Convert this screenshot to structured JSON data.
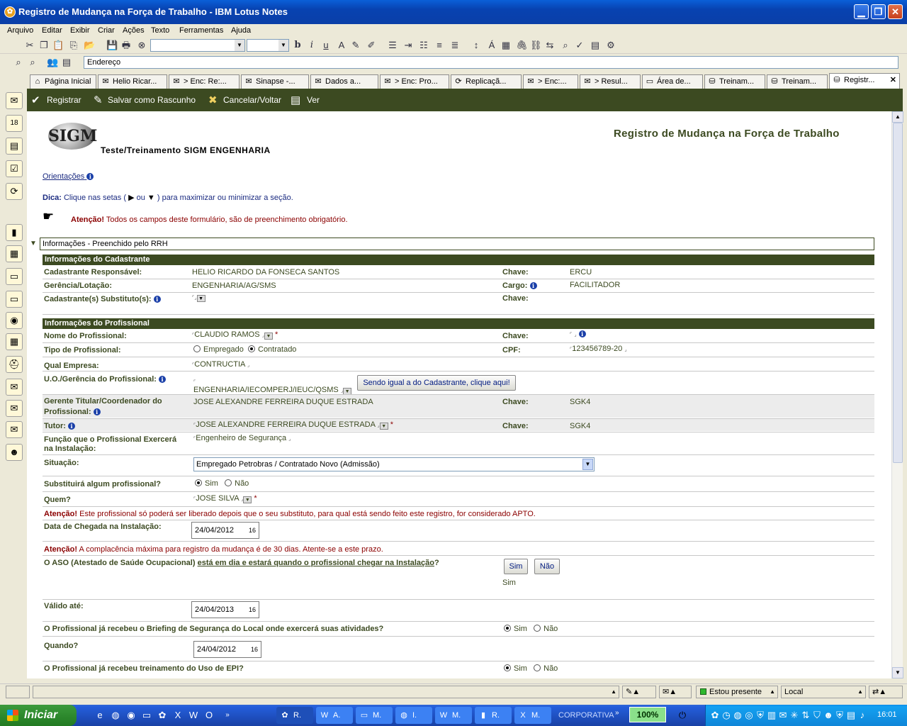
{
  "window": {
    "title": "Registro de Mudança na Força de Trabalho - IBM Lotus Notes"
  },
  "menu": [
    "Arquivo",
    "Editar",
    "Exibir",
    "Criar",
    "Ações",
    "Texto",
    "Ferramentas",
    "Ajuda"
  ],
  "address": {
    "label": "Endereço"
  },
  "tabs": [
    {
      "label": "Página Inicial",
      "icon": "home-icon"
    },
    {
      "label": "Helio Ricar...",
      "icon": "mail-icon"
    },
    {
      "label": "> Enc: Re:...",
      "icon": "memo-icon"
    },
    {
      "label": "Sinapse -...",
      "icon": "memo-icon"
    },
    {
      "label": "Dados a...",
      "icon": "memo-icon"
    },
    {
      "label": "> Enc: Pro...",
      "icon": "memo-icon"
    },
    {
      "label": "Replicaçã...",
      "icon": "replication-icon"
    },
    {
      "label": "> Enc:...",
      "icon": "memo-icon"
    },
    {
      "label": "> Resul...",
      "icon": "memo-icon"
    },
    {
      "label": "Área de...",
      "icon": "folder-icon"
    },
    {
      "label": "Treinam...",
      "icon": "database-icon"
    },
    {
      "label": "Treinam...",
      "icon": "database-icon"
    },
    {
      "label": "Registr...",
      "icon": "form-icon"
    }
  ],
  "actions": {
    "register": "Registrar",
    "save_draft": "Salvar como Rascunho",
    "cancel": "Cancelar/Voltar",
    "view": "Ver"
  },
  "form": {
    "logo_text": "SIGM",
    "subtitle": "Teste/Treinamento SIGM ENGENHARIA",
    "title": "Registro de Mudança na Força de Trabalho",
    "guidelines_link": "Orientações",
    "tip_label": "Dica:",
    "tip_text_1": "Clique nas setas (",
    "tip_text_or": "ou",
    "tip_text_2": ") para maximizar ou minimizar a seção.",
    "attention_label": "Atenção!",
    "attention_text": "Todos os campos deste formulário, são de preenchimento obrigatório.",
    "section_title": "Informações - Preenchido pelo RRH",
    "cadastrante": {
      "header": "Informações do Cadastrante",
      "responsavel_label": "Cadastrante Responsável:",
      "responsavel_value": "HELIO RICARDO DA FONSECA SANTOS",
      "chave_label": "Chave:",
      "chave_value": "ERCU",
      "gerencia_label": "Gerência/Lotação:",
      "gerencia_value": "ENGENHARIA/AG/SMS",
      "cargo_label": "Cargo:",
      "cargo_value": "FACILITADOR",
      "substituto_label": "Cadastrante(s) Substituto(s):",
      "chave2_label": "Chave:"
    },
    "profissional": {
      "header": "Informações do Profissional",
      "nome_label": "Nome do Profissional:",
      "nome_value": "CLAUDIO RAMOS",
      "chave_label": "Chave:",
      "tipo_label": "Tipo de Profissional:",
      "tipo_options": [
        "Empregado",
        "Contratado"
      ],
      "tipo_selected": "Contratado",
      "cpf_label": "CPF:",
      "cpf_value": "123456789-20",
      "empresa_label": "Qual Empresa:",
      "empresa_value": "CONTRUCTIA",
      "uo_label": "U.O./Gerência do Profissional:",
      "uo_value": "ENGENHARIA/IECOMPERJ/IEUC/QSMS",
      "uo_button": "Sendo igual a do Cadastrante, clique aqui!",
      "gerente_label_1": "Gerente Titular/Coordenador do",
      "gerente_label_2": "Profissional:",
      "gerente_value": "JOSE ALEXANDRE FERREIRA DUQUE ESTRADA",
      "gerente_chave_label": "Chave:",
      "gerente_chave_value": "SGK4",
      "tutor_label": "Tutor:",
      "tutor_value": "JOSE ALEXANDRE FERREIRA DUQUE ESTRADA",
      "tutor_chave_label": "Chave:",
      "tutor_chave_value": "SGK4",
      "funcao_label_1": "Função que o Profissional Exercerá",
      "funcao_label_2": "na Instalação:",
      "funcao_value": "Engenheiro de Segurança",
      "situacao_label": "Situação:",
      "situacao_value": "Empregado Petrobras / Contratado Novo (Admissão)",
      "substituira_label": "Substituirá algum profissional?",
      "yes_no": [
        "Sim",
        "Não"
      ],
      "substituira_selected": "Sim",
      "quem_label": "Quem?",
      "quem_value": "JOSE SILVA",
      "atencao1_label": "Atenção!",
      "atencao1_text": "Este profissional só poderá ser liberado depois que o seu substituto, para qual está sendo feito este registro, for considerado APTO.",
      "chegada_label": "Data de Chegada na Instalação:",
      "chegada_value": "24/04/2012",
      "atencao2_label": "Atenção!",
      "atencao2_text": "A complacência máxima para registro da mudança é de 30 dias. Atente-se a este prazo.",
      "aso_label_1": "O ASO (Atestado de Saúde Ocupacional)",
      "aso_label_2": "está em dia e estará quando o profissional chegar na Instalação",
      "aso_label_3": "?",
      "aso_btn_yes": "Sim",
      "aso_btn_no": "Não",
      "aso_value": "Sim",
      "valido_label": "Válido até:",
      "valido_value": "24/04/2013",
      "briefing_label": "O Profissional já recebeu o Briefing de Segurança do Local onde exercerá suas atividades?",
      "briefing_selected": "Sim",
      "quando_label": "Quando?",
      "quando_value": "24/04/2012",
      "epi_label": "O Profissional já recebeu treinamento do Uso de EPI?",
      "epi_selected": "Sim",
      "calendar_day": "16"
    }
  },
  "status": {
    "presence": "Estou presente",
    "location": "Local"
  },
  "taskbar": {
    "start": "Iniciar",
    "buttons": [
      "R.",
      "A.",
      "M.",
      "I.",
      "M.",
      "R.",
      "M."
    ],
    "corp": "CORPORATIVA",
    "zoom": "100%",
    "clock": "16:01"
  },
  "colors": {
    "accent_green": "#3c4a21",
    "title_blue": "#0842b0",
    "start_green": "#2e8a2e"
  }
}
